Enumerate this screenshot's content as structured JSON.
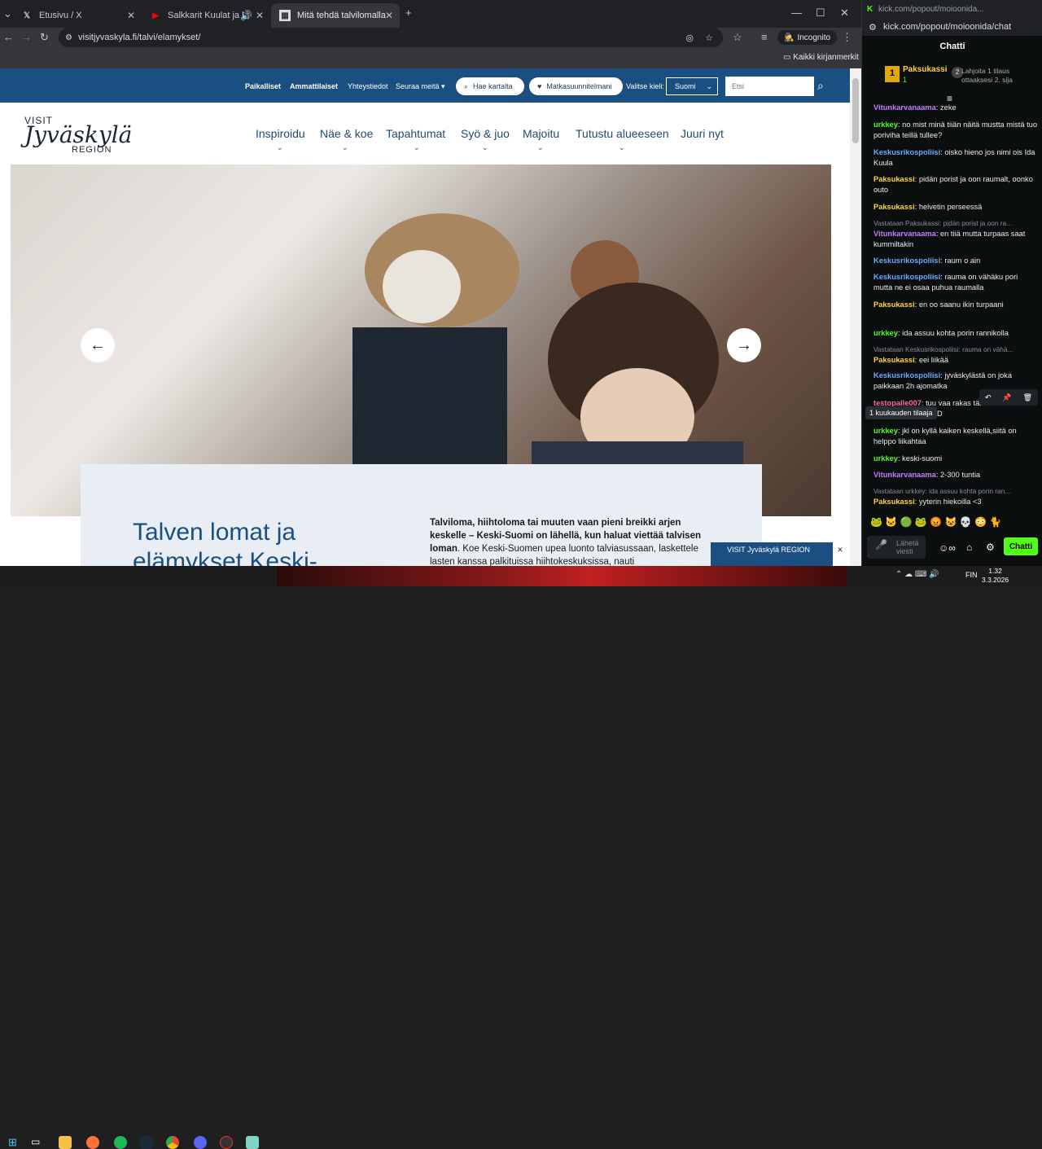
{
  "browser": {
    "tabs": [
      {
        "title": "Etusivu / X",
        "favicon": "x-icon"
      },
      {
        "title": "Salkkarit Kuulat ja kiristäjä",
        "favicon": "youtube-icon"
      },
      {
        "title": "Mitä tehdä talvilomalla Jyväskyl",
        "favicon": "site-icon"
      }
    ],
    "url": "visitjyvaskyla.fi/talvi/elamykset/",
    "incognito_label": "Incognito",
    "bookmarks_label": "Kaikki kirjanmerkit"
  },
  "site": {
    "topnav": {
      "links": [
        "Paikalliset",
        "Ammattilaiset",
        "Yhteystiedot",
        "Seuraa meitä"
      ],
      "map_button": "Hae kartalta",
      "plan_button": "Matkasuunnitelmani",
      "lang_label": "Valitse kieli:",
      "lang_value": "Suomi",
      "search_placeholder": "Etsi"
    },
    "logo": {
      "line1": "VISIT",
      "line2": "Jyväskylä",
      "line3": "REGION"
    },
    "mainnav": [
      "Inspiroidu",
      "Näe & koe",
      "Tapahtumat",
      "Syö & juo",
      "Majoitu",
      "Tutustu alueeseen",
      "Juuri nyt"
    ],
    "card": {
      "title": "Talven lomat ja",
      "title2": "elämykset Keski-",
      "text_bold": "Talviloma, hiihtoloma tai muuten vaan pieni breikki arjen keskelle – Keski-Suomi on lähellä, kun haluat viettää talvisen loman",
      "text_rest": ". Koe Keski-Suomen upea luonto talviasussaan, laskettele lasten kanssa palkituissa hiihtokeskuksissa, nauti"
    },
    "badge_text": "VISIT Jyväskylä REGION"
  },
  "chat": {
    "window_title": "kick.com/popout/moioonida...",
    "url": "kick.com/popout/moioonida/chat",
    "header": "Chatti",
    "pinned": {
      "name": "Paksukassi",
      "count": "1",
      "note": "Lahjoita 1 tilaus ottaaksesi 2. sija"
    },
    "messages": [
      {
        "user": "Vitunkarvanaama",
        "color": "#c77dff",
        "text": ": zeke"
      },
      {
        "user": "urkkey",
        "color": "#53fc18",
        "text": ": no mist minä tiiän näitä mustta mistä tuo poriviha teillä tullee?"
      },
      {
        "user": "Keskusrikospoliisi",
        "color": "#6aa9ff",
        "text": ": oisko hieno jos nimi ois Ida Kuula"
      },
      {
        "user": "Paksukassi",
        "color": "#ffd43b",
        "text": ": pidän porist ja oon raumalt, oonko outo"
      },
      {
        "user": "Paksukassi",
        "color": "#ffd43b",
        "text": ": helvetin perseessä"
      },
      {
        "reply": "Vastataan Paksukassi: pidän porist ja oon ra...",
        "user": "Vitunkarvanaama",
        "color": "#c77dff",
        "text": ": en tiiä mutta turpaas saat kummiltakin"
      },
      {
        "user": "Keskusrikospoliisi",
        "color": "#6aa9ff",
        "text": ": raum o ain"
      },
      {
        "user": "Keskusrikospoliisi",
        "color": "#6aa9ff",
        "text": ": rauma on vähäku pori mutta ne ei osaa puhua raumalla"
      },
      {
        "user": "Paksukassi",
        "color": "#ffd43b",
        "text": ": en oo saanu ikin turpaani"
      },
      {
        "user": "urkkey",
        "color": "#53fc18",
        "text": ": ida assuu kohta porin rannikolla"
      },
      {
        "reply": "Vastataan Keskusrikospoliisi: rauma on vähä...",
        "user": "Paksukassi",
        "color": "#ffd43b",
        "text": ": eei liikää"
      },
      {
        "user": "Keskusrikospoliisi",
        "color": "#6aa9ff",
        "text": ": jyväskylästä on joka paikkaan 2h ajomatka"
      },
      {
        "user": "testopalle007",
        "color": "#ff6b9d",
        "text": ": tuu vaa rakas tänne että mummotki kuulee :D"
      },
      {
        "user": "urkkey",
        "color": "#53fc18",
        "text": ": jkl on kyllä kaiken keskellä,siitä on helppo liikahtaa"
      },
      {
        "user": "urkkey",
        "color": "#53fc18",
        "text": ": keski-suomi"
      },
      {
        "user": "Vitunkarvanaama",
        "color": "#c77dff",
        "text": ": 2-300 tuntia"
      },
      {
        "reply": "Vastataan urkkey: ida assuu kohta porin ran...",
        "user": "Paksukassi",
        "color": "#ffd43b",
        "text": ": yyterin hiekoilla <3"
      }
    ],
    "tooltip": "1 kuukauden tilaaja",
    "input_placeholder": "Lähetä viesti",
    "send_label": "Chatti"
  },
  "taskbar": {
    "lang": "FIN",
    "time": "1.32",
    "date": "3.3.2026"
  }
}
